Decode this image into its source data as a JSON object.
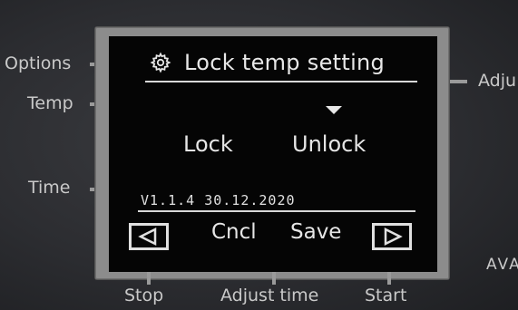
{
  "side_labels": {
    "options": "Options",
    "temp": "Temp",
    "time": "Time",
    "adjust_right": "Adju",
    "ava": "AVA"
  },
  "bottom_labels": {
    "stop": "Stop",
    "adjust_time": "Adjust time",
    "start": "Start"
  },
  "screen": {
    "title": "Lock temp setting",
    "title_icon": "gear-icon",
    "options": [
      "Lock",
      "Unlock"
    ],
    "selected_option": "Unlock",
    "version": "V1.1.4 30.12.2020",
    "softkeys": {
      "cancel": "Cncl",
      "save": "Save",
      "left_icon": "left-arrow-icon",
      "right_icon": "right-arrow-icon"
    }
  },
  "colors": {
    "screen_bg": "#050505",
    "screen_text": "#e6e6e6",
    "bezel": "#8c8c8c",
    "panel_label": "#c9c9c9"
  }
}
